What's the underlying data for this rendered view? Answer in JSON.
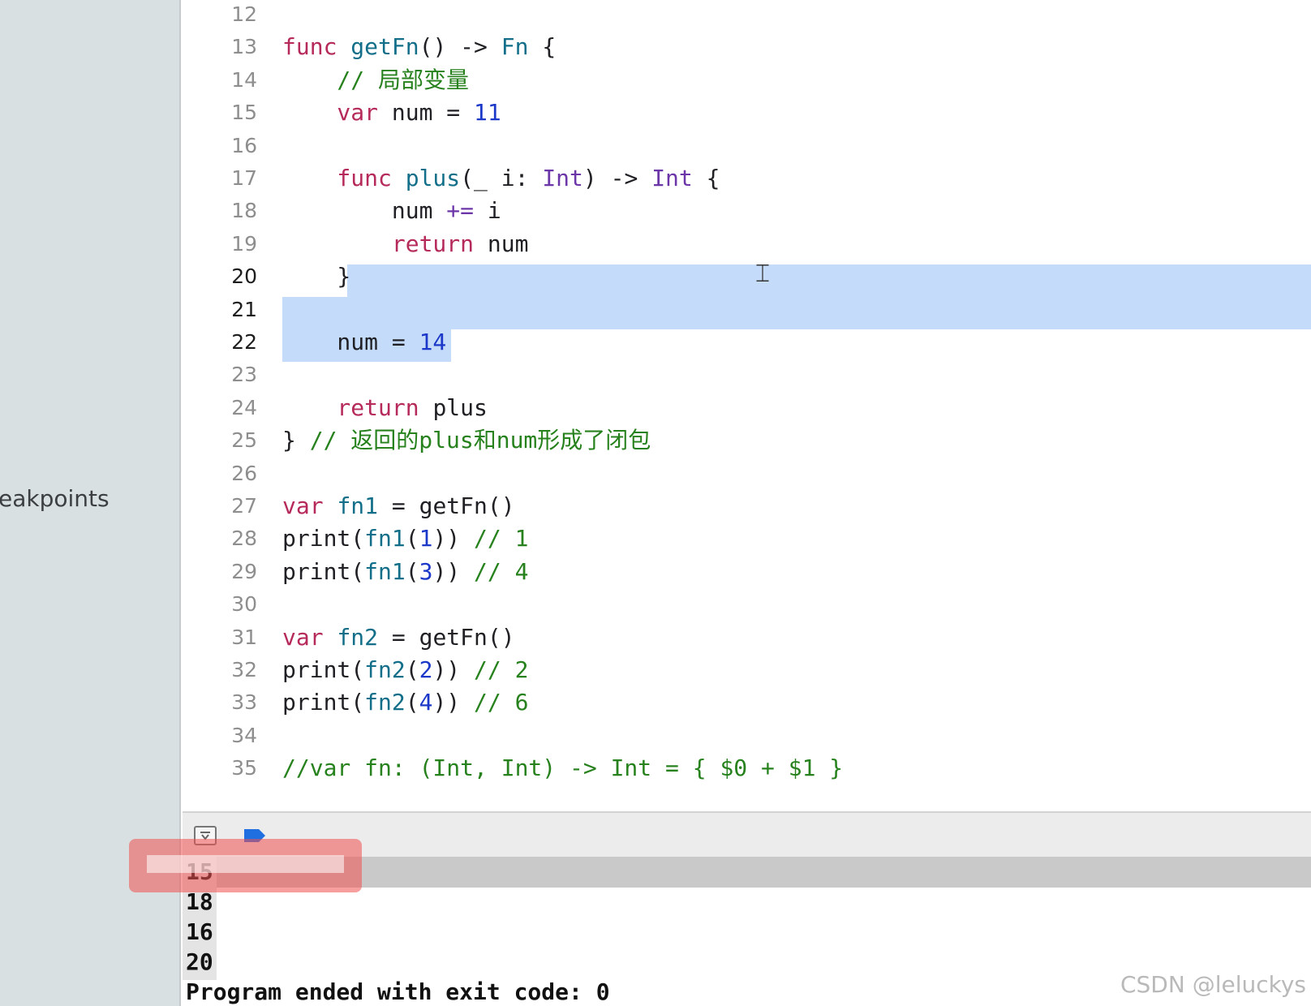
{
  "sidebar": {
    "partial_label": "eakpoints"
  },
  "editor": {
    "lines": [
      {
        "n": "12",
        "tokens": []
      },
      {
        "n": "13",
        "tokens": [
          [
            "kw",
            "func "
          ],
          [
            "fn",
            "getFn"
          ],
          [
            "plain",
            "() -> "
          ],
          [
            "fn",
            "Fn"
          ],
          [
            "plain",
            " {"
          ]
        ]
      },
      {
        "n": "14",
        "tokens": [
          [
            "cm",
            "    // 局部变量"
          ]
        ]
      },
      {
        "n": "15",
        "tokens": [
          [
            "kw",
            "    var "
          ],
          [
            "plain",
            "num = "
          ],
          [
            "num",
            "11"
          ]
        ]
      },
      {
        "n": "16",
        "tokens": []
      },
      {
        "n": "17",
        "tokens": [
          [
            "kw",
            "    func "
          ],
          [
            "fn",
            "plus"
          ],
          [
            "plain",
            "(_ i: "
          ],
          [
            "ty",
            "Int"
          ],
          [
            "plain",
            ") -> "
          ],
          [
            "ty",
            "Int"
          ],
          [
            "plain",
            " {"
          ]
        ]
      },
      {
        "n": "18",
        "tokens": [
          [
            "plain",
            "        num "
          ],
          [
            "ty",
            "+="
          ],
          [
            "plain",
            " i"
          ]
        ]
      },
      {
        "n": "19",
        "tokens": [
          [
            "kw",
            "        return "
          ],
          [
            "plain",
            "num"
          ]
        ]
      },
      {
        "n": "20",
        "tokens": [
          [
            "plain",
            "    }"
          ]
        ]
      },
      {
        "n": "21",
        "tokens": []
      },
      {
        "n": "22",
        "tokens": [
          [
            "plain",
            "    num = "
          ],
          [
            "num",
            "14"
          ]
        ]
      },
      {
        "n": "23",
        "tokens": []
      },
      {
        "n": "24",
        "tokens": [
          [
            "kw",
            "    return "
          ],
          [
            "plain",
            "plus"
          ]
        ]
      },
      {
        "n": "25",
        "tokens": [
          [
            "plain",
            "} "
          ],
          [
            "cm",
            "// 返回的plus和num形成了闭包"
          ]
        ]
      },
      {
        "n": "26",
        "tokens": []
      },
      {
        "n": "27",
        "tokens": [
          [
            "kw",
            "var "
          ],
          [
            "fn",
            "fn1"
          ],
          [
            "plain",
            " = getFn()"
          ]
        ]
      },
      {
        "n": "28",
        "tokens": [
          [
            "plain",
            "print("
          ],
          [
            "fn",
            "fn1"
          ],
          [
            "plain",
            "("
          ],
          [
            "num",
            "1"
          ],
          [
            "plain",
            ")) "
          ],
          [
            "cm",
            "// 1"
          ]
        ]
      },
      {
        "n": "29",
        "tokens": [
          [
            "plain",
            "print("
          ],
          [
            "fn",
            "fn1"
          ],
          [
            "plain",
            "("
          ],
          [
            "num",
            "3"
          ],
          [
            "plain",
            ")) "
          ],
          [
            "cm",
            "// 4"
          ]
        ]
      },
      {
        "n": "30",
        "tokens": []
      },
      {
        "n": "31",
        "tokens": [
          [
            "kw",
            "var "
          ],
          [
            "fn",
            "fn2"
          ],
          [
            "plain",
            " = getFn()"
          ]
        ]
      },
      {
        "n": "32",
        "tokens": [
          [
            "plain",
            "print("
          ],
          [
            "fn",
            "fn2"
          ],
          [
            "plain",
            "("
          ],
          [
            "num",
            "2"
          ],
          [
            "plain",
            ")) "
          ],
          [
            "cm",
            "// 2"
          ]
        ]
      },
      {
        "n": "33",
        "tokens": [
          [
            "plain",
            "print("
          ],
          [
            "fn",
            "fn2"
          ],
          [
            "plain",
            "("
          ],
          [
            "num",
            "4"
          ],
          [
            "plain",
            ")) "
          ],
          [
            "cm",
            "// 6"
          ]
        ]
      },
      {
        "n": "34",
        "tokens": []
      },
      {
        "n": "35",
        "tokens": [
          [
            "cm",
            "//var fn: (Int, Int) -> Int = { $0 + $1 }"
          ]
        ]
      }
    ],
    "current_lines": [
      "20",
      "21",
      "22"
    ]
  },
  "console": {
    "lines": [
      "15",
      "18",
      "16",
      "20",
      "Program ended with exit code: 0"
    ]
  },
  "watermark": "CSDN @leluckys",
  "colors": {
    "keyword": "#b5295b",
    "type": "#6c36a8",
    "function": "#136f89",
    "number": "#1c38c9",
    "comment": "#27821e",
    "selection": "#c4dcfa"
  }
}
